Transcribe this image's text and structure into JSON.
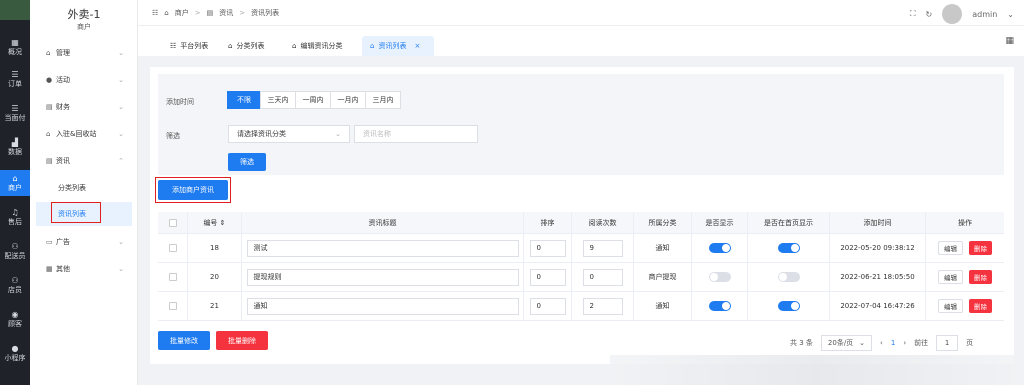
{
  "rail": {
    "items": [
      {
        "icon": "dashboard-icon",
        "glyph": "▦",
        "label": "概况"
      },
      {
        "icon": "order-icon",
        "glyph": "☰",
        "label": "订单"
      },
      {
        "icon": "pay-icon",
        "glyph": "☰",
        "label": "当面付"
      },
      {
        "icon": "chart-icon",
        "glyph": "▟",
        "label": "数据"
      },
      {
        "icon": "store-icon",
        "glyph": "⌂",
        "label": "商户"
      },
      {
        "icon": "headset-icon",
        "glyph": "♫",
        "label": "售后"
      },
      {
        "icon": "courier-icon",
        "glyph": "⚇",
        "label": "配送员"
      },
      {
        "icon": "staff-icon",
        "glyph": "⚇",
        "label": "店员"
      },
      {
        "icon": "customer-icon",
        "glyph": "◉",
        "label": "顾客"
      },
      {
        "icon": "miniapp-icon",
        "glyph": "●",
        "label": "小程序"
      }
    ]
  },
  "sidebar": {
    "title": "外卖-1",
    "subtitle": "商户",
    "items": [
      {
        "label": "管理",
        "glyph": "⌂"
      },
      {
        "label": "活动",
        "glyph": "●"
      },
      {
        "label": "财务",
        "glyph": "▤"
      },
      {
        "label": "入驻&回收站",
        "glyph": "⌂"
      },
      {
        "label": "资讯",
        "glyph": "▤"
      },
      {
        "label": "广告",
        "glyph": "▭"
      },
      {
        "label": "其他",
        "glyph": "▦"
      }
    ],
    "sub_items": [
      "分类列表",
      "资讯列表"
    ]
  },
  "topbar": {
    "crumbs": [
      "商户",
      "资讯",
      "资讯列表"
    ],
    "user": "admin"
  },
  "tabs": [
    {
      "label": "平台列表"
    },
    {
      "label": "分类列表"
    },
    {
      "label": "编辑资讯分类"
    },
    {
      "label": "资讯列表"
    }
  ],
  "filter": {
    "time_label": "添加时间",
    "time_options": [
      "不限",
      "三天内",
      "一周内",
      "一月内",
      "三月内"
    ],
    "filter_label": "筛选",
    "category_placeholder": "请选择资讯分类",
    "name_placeholder": "资讯名称",
    "search_button": "筛选"
  },
  "add_button": "添加商户资讯",
  "table": {
    "headers": [
      "编号",
      "资讯标题",
      "排序",
      "阅读次数",
      "所属分类",
      "是否显示",
      "是否在首页显示",
      "添加时间",
      "操作"
    ],
    "rows": [
      {
        "id": "18",
        "title": "测试",
        "sort": "0",
        "reads": "9",
        "category": "通知",
        "show": true,
        "home": true,
        "time": "2022-05-20 09:38:12"
      },
      {
        "id": "20",
        "title": "提现规则",
        "sort": "0",
        "reads": "0",
        "category": "商户提现",
        "show": false,
        "home": false,
        "time": "2022-06-21 18:05:50"
      },
      {
        "id": "21",
        "title": "通知",
        "sort": "0",
        "reads": "2",
        "category": "通知",
        "show": true,
        "home": true,
        "time": "2022-07-04 16:47:26"
      }
    ],
    "edit_label": "编辑",
    "delete_label": "删除"
  },
  "bulk": {
    "edit": "批量修改",
    "delete": "批量删除"
  },
  "pager": {
    "total": "共 3 条",
    "page_size": "20条/页",
    "current": "1",
    "goto_prefix": "前往",
    "goto_value": "1",
    "goto_suffix": "页"
  },
  "colors": {
    "accent": "#1e7bf0",
    "danger": "#f5333f",
    "rail_bg": "#20222a"
  }
}
